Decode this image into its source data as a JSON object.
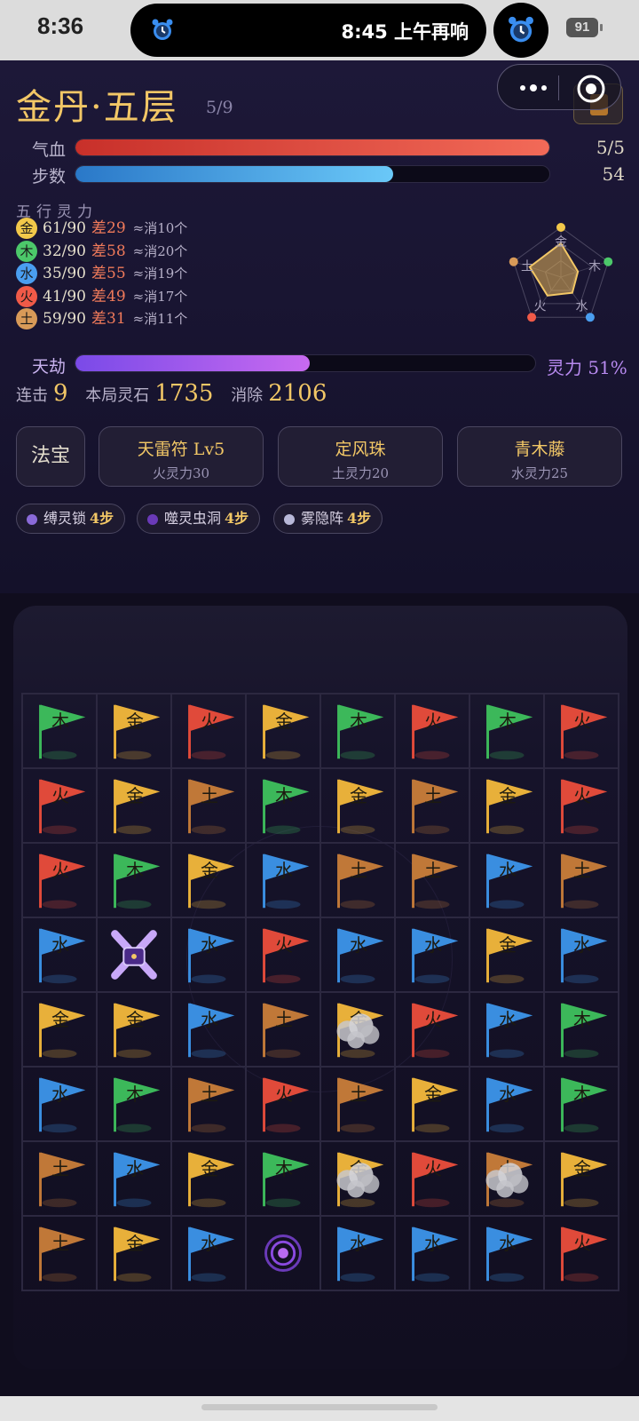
{
  "status_bar": {
    "time": "8:36",
    "alarm_text": "8:45 上午再响",
    "battery": "91"
  },
  "header": {
    "title": "金丹·五层",
    "progress": "5/9"
  },
  "stats_bars": [
    {
      "label": "气血",
      "value": "5/5",
      "fraction": 1.0,
      "color": "#e45a4a"
    },
    {
      "label": "步数",
      "value": "54",
      "fraction": 0.67,
      "color": "#4aa8e8"
    }
  ],
  "wuxing": {
    "heading": "五行灵力",
    "rows": [
      {
        "char": "金",
        "color": "#f2c84a",
        "current": "61/90",
        "diff": "差29",
        "approx": "≈消10个"
      },
      {
        "char": "木",
        "color": "#4cc86a",
        "current": "32/90",
        "diff": "差58",
        "approx": "≈消20个"
      },
      {
        "char": "水",
        "color": "#4a9ef0",
        "current": "35/90",
        "diff": "差55",
        "approx": "≈消19个"
      },
      {
        "char": "火",
        "color": "#f05a48",
        "current": "41/90",
        "diff": "差49",
        "approx": "≈消17个"
      },
      {
        "char": "土",
        "color": "#d89a58",
        "current": "59/90",
        "diff": "差31",
        "approx": "≈消11个"
      }
    ],
    "radar_labels": [
      "金",
      "木",
      "水",
      "火",
      "土"
    ],
    "radar_values": [
      0.68,
      0.36,
      0.39,
      0.46,
      0.66
    ]
  },
  "tianjie": {
    "label": "天劫",
    "value_text": "灵力 51%",
    "fraction": 0.51
  },
  "score": {
    "combo_label": "连击",
    "combo": "9",
    "stones_label": "本局灵石",
    "stones": "1735",
    "clear_label": "消除",
    "clear": "2106"
  },
  "treasures": {
    "fabao_label": "法宝",
    "items": [
      {
        "name": "天雷符 Lv5",
        "cost": "火灵力30"
      },
      {
        "name": "定风珠",
        "cost": "土灵力20"
      },
      {
        "name": "青木藤",
        "cost": "水灵力25"
      }
    ]
  },
  "effects": [
    {
      "name": "缚灵锁",
      "steps": "4步",
      "dot": "#8a6ad8"
    },
    {
      "name": "噬灵虫洞",
      "steps": "4步",
      "dot": "#6a3ab8"
    },
    {
      "name": "雾隐阵",
      "steps": "4步",
      "dot": "#b8b8d8"
    }
  ],
  "element_colors": {
    "金": "#e8b03a",
    "木": "#3cb85a",
    "水": "#3a8ee0",
    "火": "#e04a3a",
    "土": "#c07838"
  },
  "board": [
    [
      "木",
      "金",
      "火",
      "金",
      "木",
      "火",
      "木",
      "火"
    ],
    [
      "火",
      "金",
      "土",
      "木",
      "金",
      "土",
      "金",
      "火"
    ],
    [
      "火",
      "木",
      "金",
      "水",
      "土",
      "土",
      "水",
      "土"
    ],
    [
      "水",
      "LOCK",
      "水",
      "火",
      "水",
      "水",
      "金",
      "水"
    ],
    [
      "金",
      "金",
      "水",
      "土",
      "金",
      "火",
      "水",
      "木"
    ],
    [
      "水",
      "木",
      "土",
      "火",
      "土",
      "金",
      "水",
      "木"
    ],
    [
      "土",
      "水",
      "金",
      "木",
      "金",
      "火",
      "土",
      "金"
    ],
    [
      "土",
      "金",
      "水",
      "VORTEX",
      "水",
      "水",
      "水",
      "火"
    ]
  ],
  "fog_cells": [
    "4-4",
    "6-4",
    "6-6"
  ]
}
